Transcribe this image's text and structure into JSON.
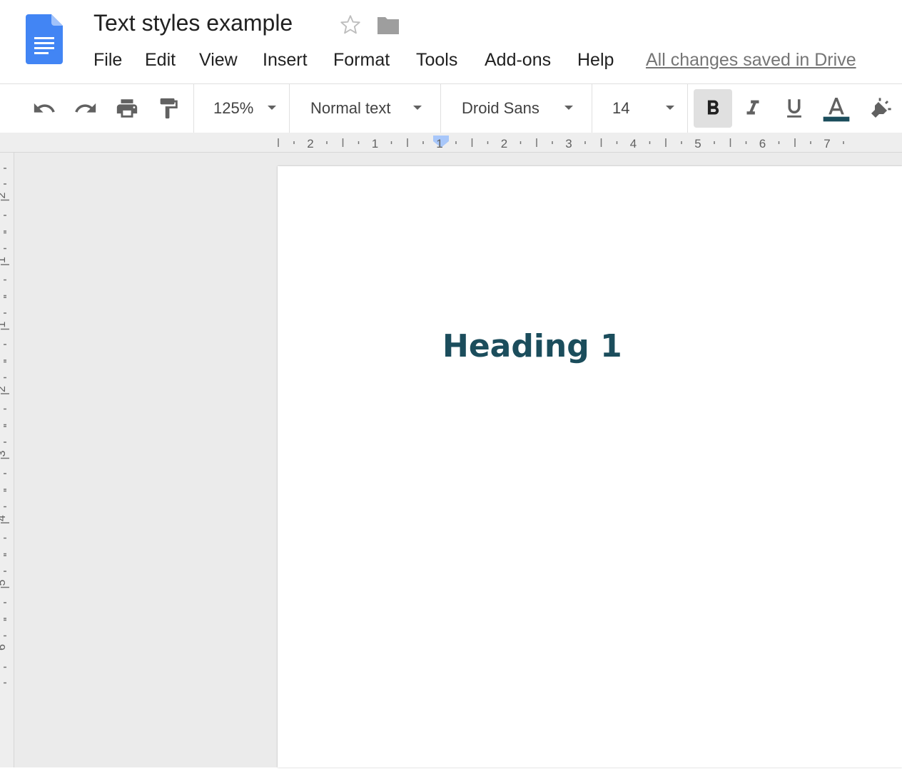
{
  "app": {
    "title": "Text styles example",
    "save_status": "All changes saved in Drive"
  },
  "menu": {
    "items": [
      "File",
      "Edit",
      "View",
      "Insert",
      "Format",
      "Tools",
      "Add-ons",
      "Help"
    ]
  },
  "toolbar": {
    "zoom": "125%",
    "style": "Normal text",
    "font": "Droid Sans",
    "font_size": "14",
    "text_color": "#1b4d5c",
    "bold_active": true
  },
  "ruler": {
    "h_labels": [
      "2",
      "1",
      "1",
      "2",
      "3",
      "4",
      "5",
      "6",
      "7"
    ],
    "v_labels": [
      "2",
      "1",
      "1",
      "2",
      "3",
      "4",
      "5",
      "6"
    ]
  },
  "document": {
    "heading": "Heading 1"
  },
  "colors": {
    "accent": "#4285f4",
    "heading": "#1b4d5c"
  },
  "icons": {
    "doc": "google-docs-icon",
    "star": "star-outline-icon",
    "folder": "folder-icon",
    "undo": "undo-icon",
    "redo": "redo-icon",
    "print": "print-icon",
    "paint": "paint-format-icon",
    "bold": "bold-icon",
    "italic": "italic-icon",
    "underline": "underline-icon",
    "text_color": "text-color-icon",
    "highlight": "highlight-icon"
  }
}
